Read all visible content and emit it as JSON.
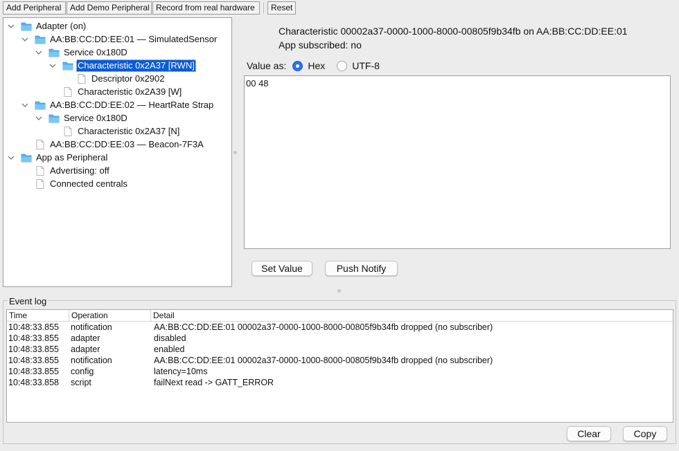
{
  "toolbar": {
    "add_peripheral": "Add Peripheral",
    "add_demo_peripheral": "Add Demo Peripheral",
    "record_hardware": "Record from real hardware",
    "reset": "Reset"
  },
  "tree": {
    "adapter": "Adapter (on)",
    "device1": "AA:BB:CC:DD:EE:01 — SimulatedSensor",
    "device1_service": "Service 0x180D",
    "device1_char1": "Characteristic 0x2A37 [RWN]",
    "device1_char1_desc": "Descriptor 0x2902",
    "device1_char2": "Characteristic 0x2A39 [W]",
    "device2": "AA:BB:CC:DD:EE:02 — HeartRate Strap",
    "device2_service": "Service 0x180D",
    "device2_char1": "Characteristic 0x2A37 [N]",
    "device3": "AA:BB:CC:DD:EE:03 — Beacon-7F3A",
    "app_peripheral": "App as Peripheral",
    "advertising": "Advertising: off",
    "connected_centrals": "Connected centrals"
  },
  "detail": {
    "title": "Characteristic 00002a37-0000-1000-8000-00805f9b34fb on AA:BB:CC:DD:EE:01",
    "subscribed": "App subscribed: no",
    "value_as_label": "Value as:",
    "format_options": [
      "Hex",
      "UTF-8"
    ],
    "selected_format": "Hex",
    "value": "00 48",
    "set_value_button": "Set Value",
    "push_notify_button": "Push Notify"
  },
  "event_log": {
    "title": "Event log",
    "columns": [
      "Time",
      "Operation",
      "Detail"
    ],
    "rows": [
      [
        "10:48:33.855",
        "notification",
        "AA:BB:CC:DD:EE:01 00002a37-0000-1000-8000-00805f9b34fb dropped (no subscriber)"
      ],
      [
        "10:48:33.855",
        "adapter",
        "disabled"
      ],
      [
        "10:48:33.855",
        "adapter",
        "enabled"
      ],
      [
        "10:48:33.855",
        "notification",
        "AA:BB:CC:DD:EE:01 00002a37-0000-1000-8000-00805f9b34fb dropped (no subscriber)"
      ],
      [
        "10:48:33.855",
        "config",
        "latency=10ms"
      ],
      [
        "10:48:33.858",
        "script",
        "failNext read -> GATT_ERROR"
      ]
    ],
    "clear_button": "Clear",
    "copy_button": "Copy"
  },
  "colors": {
    "selection": "#0b5bd3",
    "folder": "#5ab4ee",
    "radio_on": "#2b72e6"
  }
}
